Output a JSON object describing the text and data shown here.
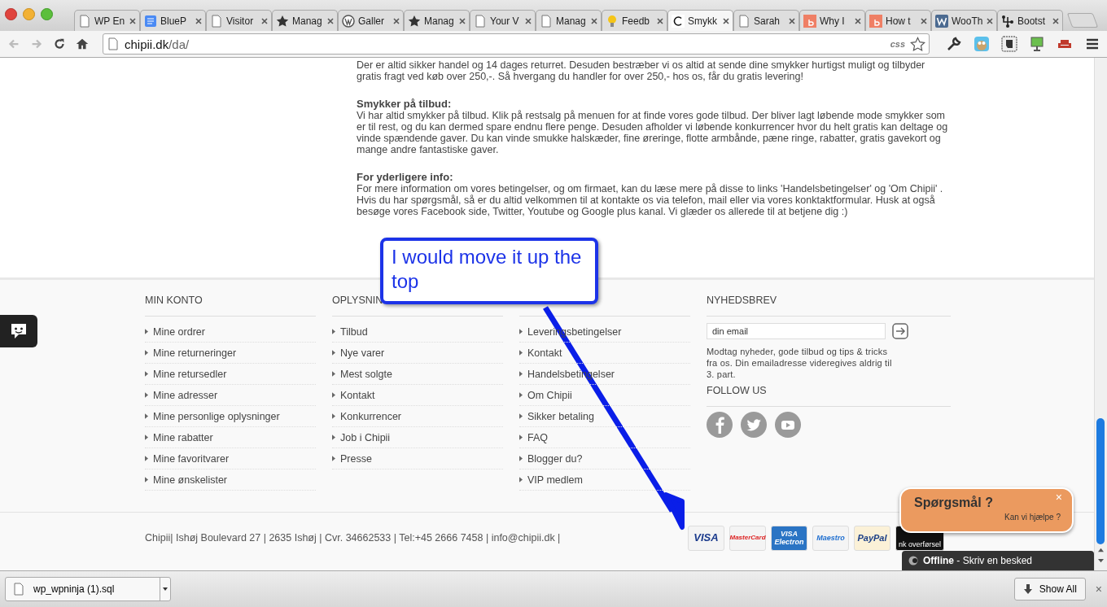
{
  "browser": {
    "tabs": [
      {
        "title": "WP En",
        "kind": "page",
        "selected": false
      },
      {
        "title": "BlueP",
        "kind": "docs",
        "selected": false
      },
      {
        "title": "Visitor",
        "kind": "page",
        "selected": false
      },
      {
        "title": "Manag",
        "kind": "star",
        "selected": false
      },
      {
        "title": "Galler",
        "kind": "wordpress",
        "selected": false
      },
      {
        "title": "Manag",
        "kind": "star",
        "selected": false
      },
      {
        "title": "Your V",
        "kind": "page",
        "selected": false
      },
      {
        "title": "Manag",
        "kind": "page",
        "selected": false
      },
      {
        "title": "Feedb",
        "kind": "bulb",
        "selected": false
      },
      {
        "title": "Smykk",
        "kind": "letter",
        "selected": true
      },
      {
        "title": "Sarah",
        "kind": "page",
        "selected": false
      },
      {
        "title": "Why I",
        "kind": "blogger",
        "selected": false
      },
      {
        "title": "How t",
        "kind": "blogger",
        "selected": false
      },
      {
        "title": "WooTh",
        "kind": "square-letter",
        "selected": false
      },
      {
        "title": "Bootst",
        "kind": "nodes",
        "selected": false
      }
    ],
    "address": {
      "host": "chipii.dk",
      "path": "/da/"
    },
    "address_badge": "css"
  },
  "page": {
    "intro": "Der er altid sikker handel og 14 dages returret. Desuden bestræber vi os altid at sende dine smykker hurtigst muligt og tilbyder gratis fragt ved køb over 250,-. Så hvergang du handler for over 250,- hos os, får du gratis levering!",
    "sections": [
      {
        "heading": "Smykker på tilbud:",
        "text": "Vi har altid smykker på tilbud. Klik på restsalg på menuen for at finde vores gode tilbud. Der bliver lagt løbende mode smykker som er til rest, og du kan dermed spare endnu flere penge. Desuden afholder vi løbende konkurrencer hvor du helt gratis kan deltage og vinde spændende gaver. Du kan vinde smukke halskæder, fine øreringe, flotte armbånde, pæne ringe, rabatter, gratis gavekort og mange andre fantastiske gaver."
      },
      {
        "heading": "For yderligere info:",
        "text": "For mere information om vores betingelser, og om firmaet, kan du læse mere på disse to links 'Handelsbetingelser' og 'Om Chipii' . Hvis du har spørgsmål, så er du altid velkommen til at kontakte os via telefon, mail eller via vores konktaktformular. Husk at også besøge vores Facebook side, Twitter, Youtube og Google plus kanal. Vi glæder os allerede til at betjene dig :)"
      }
    ]
  },
  "footer": {
    "columns": [
      {
        "heading": "MIN KONTO",
        "links": [
          "Mine ordrer",
          "Mine returneringer",
          "Mine retursedler",
          "Mine adresser",
          "Mine personlige oplysninger",
          "Mine rabatter",
          "Mine favoritvarer",
          "Mine ønskelister"
        ]
      },
      {
        "heading": "OPLYSNIN",
        "links": [
          "Tilbud",
          "Nye varer",
          "Mest solgte",
          "Kontakt",
          "Konkurrencer",
          "Job i Chipii",
          "Presse"
        ]
      },
      {
        "links": [
          "Leveringsbetingelser",
          "Kontakt",
          "Handelsbetingelser",
          "Om Chipii",
          "Sikker betaling",
          "FAQ",
          "Blogger du?",
          "VIP medlem"
        ]
      }
    ],
    "newsletter": {
      "heading": "NYHEDSBREV",
      "placeholder": "din email",
      "note": "Modtag nyheder, gode tilbud og tips & tricks fra os. Din emailadresse videregives aldrig til 3. part.",
      "follow_heading": "FOLLOW US"
    },
    "contact": "Chipii| Ishøj Boulevard 27 | 2635 Ishøj | Cvr. 34662533 | Tel:+45 2666 7458 | info@chipii.dk |",
    "payment_cards": [
      {
        "kind": "visa",
        "label": "VISA"
      },
      {
        "kind": "mastercard",
        "label": "MasterCard"
      },
      {
        "kind": "visa-electron",
        "label": "VISA Electron"
      },
      {
        "kind": "maestro",
        "label": "Maestro"
      },
      {
        "kind": "paypal",
        "label": "PayPal"
      },
      {
        "kind": "bank",
        "label": "nk overførsel"
      }
    ]
  },
  "annotation": {
    "text": "I would move it up the top"
  },
  "chat": {
    "title": "Spørgsmål ?",
    "subtitle": "Kan vi hjælpe ?",
    "close": "×",
    "status": "**Offline** - Skriv en besked"
  },
  "downloads": {
    "file": "wp_wpninja (1).sql",
    "show_all": "Show All",
    "close": "×"
  }
}
